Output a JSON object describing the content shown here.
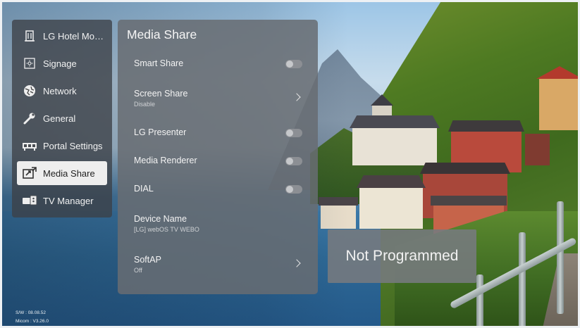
{
  "sidebar": {
    "items": [
      {
        "label": "LG Hotel Mod...",
        "icon": "building-icon",
        "active": false
      },
      {
        "label": "Signage",
        "icon": "signage-icon",
        "active": false
      },
      {
        "label": "Network",
        "icon": "network-globe-icon",
        "active": false
      },
      {
        "label": "General",
        "icon": "wrench-icon",
        "active": false
      },
      {
        "label": "Portal Settings",
        "icon": "portal-icon",
        "active": false
      },
      {
        "label": "Media Share",
        "icon": "media-share-icon",
        "active": true
      },
      {
        "label": "TV Manager",
        "icon": "tv-manager-icon",
        "active": false
      }
    ]
  },
  "panel": {
    "title": "Media Share",
    "rows": [
      {
        "label": "Smart Share",
        "control": "toggle",
        "value": "off"
      },
      {
        "label": "Screen Share",
        "sub": "Disable",
        "control": "chevron"
      },
      {
        "label": "LG Presenter",
        "control": "toggle",
        "value": "off"
      },
      {
        "label": "Media Renderer",
        "control": "toggle",
        "value": "off"
      },
      {
        "label": "DIAL",
        "control": "toggle",
        "value": "off"
      },
      {
        "label": "Device Name",
        "sub": "[LG] webOS TV WEBO",
        "control": "none"
      },
      {
        "label": "SoftAP",
        "sub": "Off",
        "control": "chevron"
      }
    ]
  },
  "toast": {
    "text": "Not Programmed"
  },
  "version": {
    "sw": "S/W : 08.08.52",
    "micom": "Micom : V3.26.0"
  },
  "colors": {
    "active_item_bg": "#eeeeee",
    "panel_bg": "#686c72",
    "sidebar_bg": "#3c4046"
  }
}
